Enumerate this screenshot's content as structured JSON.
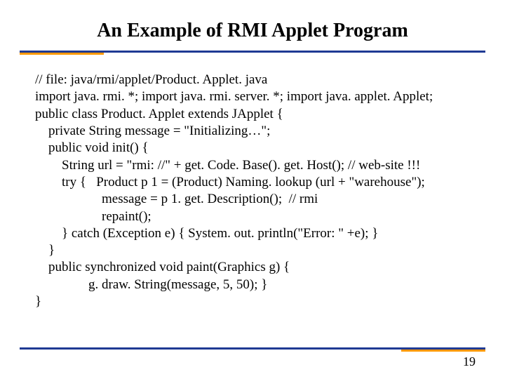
{
  "title": "An Example of RMI Applet Program",
  "code": {
    "l1": "// file: java/rmi/applet/Product. Applet. java",
    "l2": "import java. rmi. *; import java. rmi. server. *; import java. applet. Applet;",
    "l3": "public class Product. Applet extends JApplet {",
    "l4": "    private String message = \"Initializing…\";",
    "l5": "    public void init() {",
    "l6": "        String url = \"rmi: //\" + get. Code. Base(). get. Host(); // web-site !!!",
    "l7": "        try {   Product p 1 = (Product) Naming. lookup (url + \"warehouse\");",
    "l8": "                    message = p 1. get. Description();  // rmi",
    "l9": "                    repaint();",
    "l10": "        } catch (Exception e) { System. out. println(\"Error: \" +e); }",
    "l11": "    }",
    "l12": "    public synchronized void paint(Graphics g) {",
    "l13": "                g. draw. String(message, 5, 50); }",
    "l14": "}"
  },
  "pagenum": "19"
}
